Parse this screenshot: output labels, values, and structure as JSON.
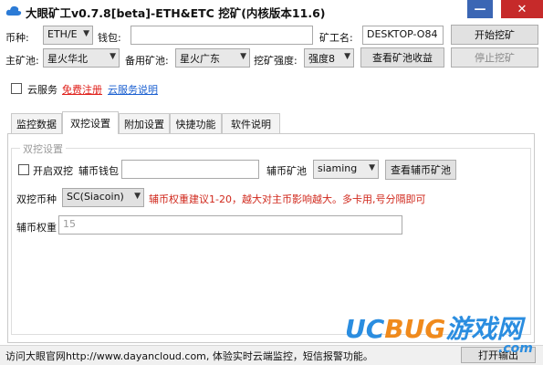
{
  "window": {
    "title": "大眼矿工v0.7.8[beta]-ETH&ETC 挖矿(内核版本11.6)",
    "minimize_glyph": "—",
    "close_glyph": "✕"
  },
  "top": {
    "coin_label": "币种:",
    "coin_value": "ETH/E",
    "wallet_label": "钱包:",
    "wallet_value": "",
    "worker_label": "矿工名:",
    "worker_value": "DESKTOP-O84",
    "start_button": "开始挖矿",
    "main_pool_label": "主矿池:",
    "main_pool_value": "星火华北",
    "backup_pool_label": "备用矿池:",
    "backup_pool_value": "星火广东",
    "intensity_label": "挖矿强度:",
    "intensity_value": "强度8",
    "view_pool_button": "查看矿池收益",
    "stop_button": "停止挖矿"
  },
  "cloud": {
    "checkbox_label": "云服务",
    "register_link": "免费注册",
    "help_link": "云服务说明"
  },
  "tabs": [
    {
      "label": "监控数据"
    },
    {
      "label": "双挖设置"
    },
    {
      "label": "附加设置"
    },
    {
      "label": "快捷功能"
    },
    {
      "label": "软件说明"
    }
  ],
  "dual": {
    "group_title": "双挖设置",
    "enable_label": "开启双挖",
    "wallet_label": "辅币钱包",
    "wallet_value": "",
    "pool_label": "辅币矿池",
    "pool_value": "siaming",
    "view_pool_button": "查看辅币矿池",
    "coin_label": "双挖币种",
    "coin_value": "SC(Siacoin)",
    "hint": "辅币权重建议1-20，越大对主币影响越大。多卡用,号分隔即可",
    "weight_label": "辅币权重",
    "weight_value": "15"
  },
  "status": {
    "text": "访问大眼官网http://www.dayancloud.com, 体验实时云端监控，短信报警功能。",
    "open_output_button": "打开输出"
  },
  "watermark": {
    "text": "UCBUG游戏网",
    "sub": ".com"
  },
  "colors": {
    "accent_red": "#e0201b",
    "link_blue": "#1a5fd0",
    "close_red": "#c62a2a",
    "minimize_blue": "#3b66b4"
  }
}
